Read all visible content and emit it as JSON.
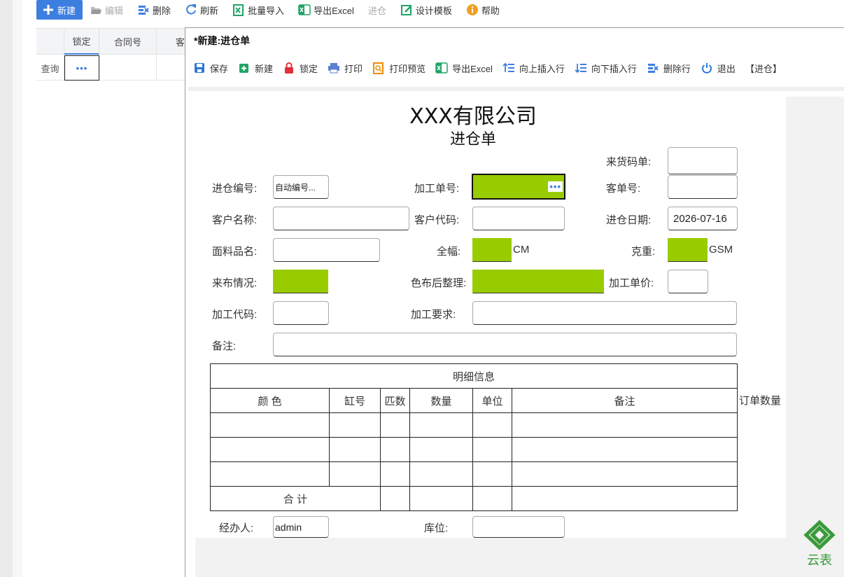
{
  "toolbar": {
    "new": "新建",
    "edit": "编辑",
    "delete": "删除",
    "refresh": "刷新",
    "import": "批量导入",
    "export": "导出Excel",
    "stock_in": "进仓",
    "design": "设计模板",
    "help": "帮助"
  },
  "grid": {
    "headers": [
      "锁定",
      "合同号",
      "客"
    ],
    "query_label": "查询",
    "ellipsis": "•••"
  },
  "modal": {
    "title": "*新建:进仓单",
    "toolbar": {
      "save": "保存",
      "new": "新建",
      "lock": "锁定",
      "print": "打印",
      "preview": "打印预览",
      "export": "导出Excel",
      "insert_up": "向上插入行",
      "insert_down": "向下插入行",
      "delete_row": "删除行",
      "exit": "退出",
      "stock_in": "【进仓】"
    }
  },
  "form": {
    "company": "XXX有限公司",
    "doc_title": "进仓单",
    "labels": {
      "delivery_code": "来货码单:",
      "stock_no": "进仓编号:",
      "process_no": "加工单号:",
      "customer_order": "客单号:",
      "customer_name": "客户名称:",
      "customer_code": "客户代码:",
      "stock_date": "进仓日期:",
      "fabric_name": "面料品名:",
      "width": "全幅:",
      "weight": "克重:",
      "fabric_status": "来布情况:",
      "finishing": "色布后整理:",
      "unit_price": "加工单价:",
      "process_code": "加工代码:",
      "process_req": "加工要求:",
      "remark": "备注:",
      "handler": "经办人:",
      "location": "库位:"
    },
    "values": {
      "stock_no": "自动编号...",
      "stock_date": "2026-07-16",
      "handler": "admin",
      "process_ellipsis": "•••"
    },
    "units": {
      "width": "CM",
      "weight": "GSM"
    }
  },
  "detail": {
    "title": "明细信息",
    "headers": [
      "颜 色",
      "缸号",
      "匹数",
      "数量",
      "单位",
      "备注"
    ],
    "total_label": "合 计",
    "extra_header": "订单数量"
  },
  "logo": {
    "text": "云表",
    "color": "#3a9a3a"
  }
}
